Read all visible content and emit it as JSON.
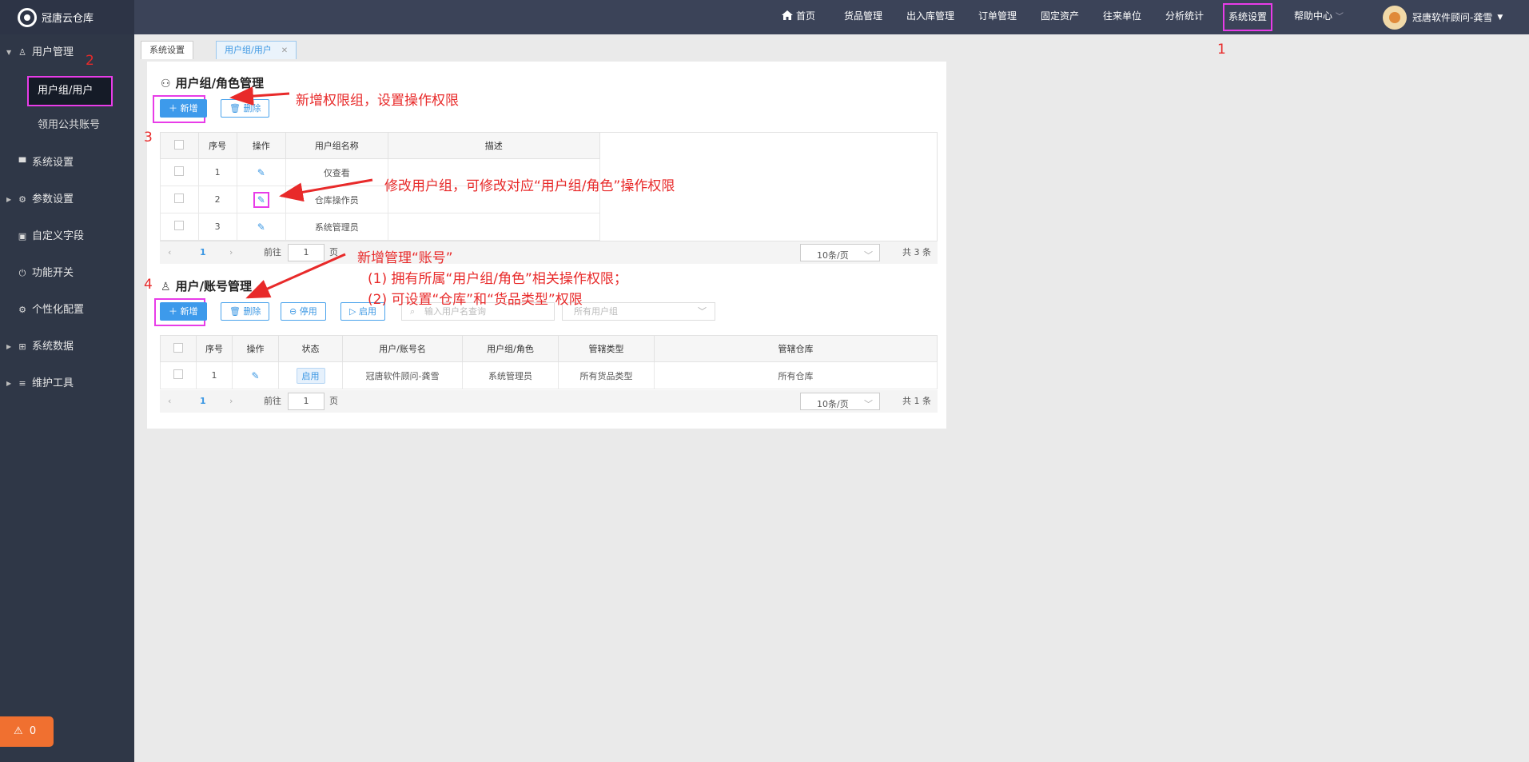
{
  "app": {
    "name": "冠唐云仓库"
  },
  "topnav": {
    "items": [
      "首页",
      "货品管理",
      "出入库管理",
      "订单管理",
      "固定资产",
      "往来单位",
      "分析统计",
      "系统设置",
      "帮助中心"
    ],
    "user": "冠唐软件顾问-龚雪"
  },
  "sidebar": {
    "user_mgmt": "用户管理",
    "sub_group": "用户组/用户",
    "sub_public": "领用公共账号",
    "system_settings": "系统设置",
    "params": "参数设置",
    "custom_fields": "自定义字段",
    "feature_switch": "功能开关",
    "personalize": "个性化配置",
    "system_data": "系统数据",
    "maintenance": "维护工具",
    "alarm_count": "0"
  },
  "tabs": [
    "系统设置",
    "用户组/用户"
  ],
  "groups": {
    "title": "用户组/角色管理",
    "add": "新增",
    "delete": "删除",
    "headers": [
      "序号",
      "操作",
      "用户组名称",
      "描述"
    ],
    "rows": [
      {
        "no": "1",
        "name": "仅查看"
      },
      {
        "no": "2",
        "name": "仓库操作员"
      },
      {
        "no": "3",
        "name": "系统管理员"
      }
    ],
    "pager": {
      "page": "1",
      "goto": "前往",
      "page_input": "1",
      "page_unit": "页",
      "page_size": "10条/页",
      "total": "共 3 条"
    }
  },
  "accounts": {
    "title": "用户/账号管理",
    "add": "新增",
    "delete": "删除",
    "disable": "停用",
    "enable": "启用",
    "search_placeholder": "输入用户名查询",
    "group_filter": "所有用户组",
    "headers": [
      "序号",
      "操作",
      "状态",
      "用户/账号名",
      "用户组/角色",
      "管辖类型",
      "管辖仓库"
    ],
    "rows": [
      {
        "no": "1",
        "status": "启用",
        "name": "冠唐软件顾问-龚雪",
        "role": "系统管理员",
        "type": "所有货品类型",
        "warehouse": "所有仓库"
      }
    ],
    "pager": {
      "page": "1",
      "goto": "前往",
      "page_input": "1",
      "page_unit": "页",
      "page_size": "10条/页",
      "total": "共 1 条"
    }
  },
  "annotations": {
    "n1": "1",
    "n2": "2",
    "n3": "3",
    "n4": "4",
    "a1": "新增权限组，设置操作权限",
    "a2": "修改用户组，可修改对应“用户组/角色”操作权限",
    "a3_title": "新增管理“账号”",
    "a3_l1": "(1) 拥有所属“用户组/角色”相关操作权限；",
    "a3_l2": "(2) 可设置“仓库”和“货品类型”权限"
  },
  "colors": {
    "accent": "#3d9aeb",
    "highlight": "#e83ce8",
    "annotation": "#e82a2a",
    "sidebar": "#2f3747",
    "topbar": "#3b4358"
  }
}
